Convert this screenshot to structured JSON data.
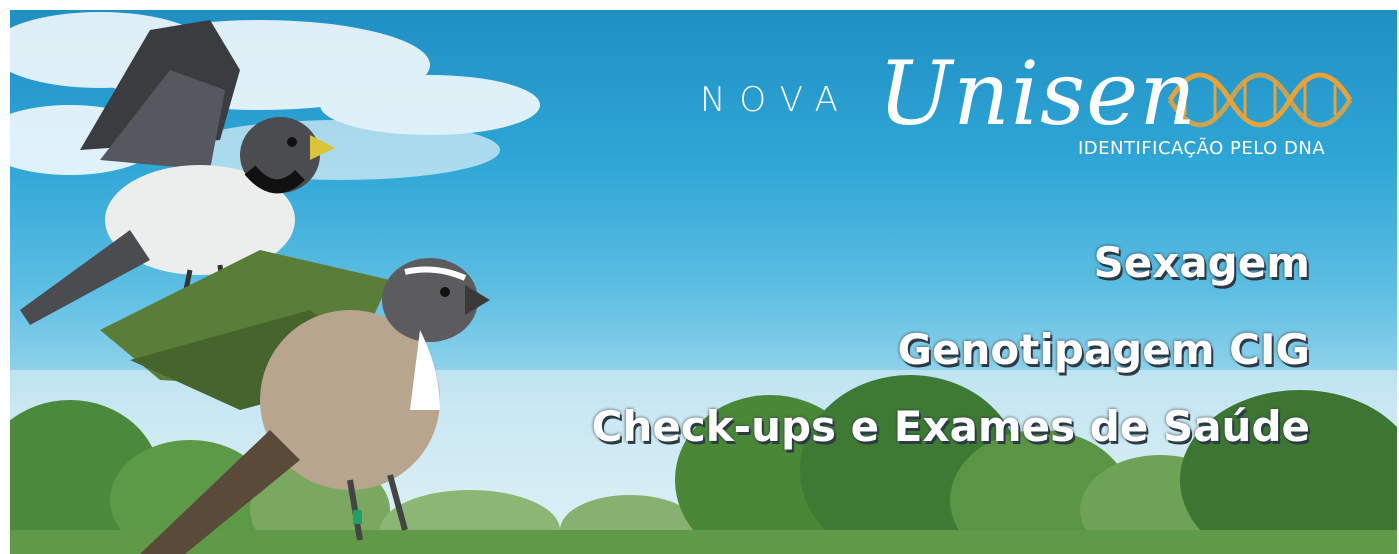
{
  "brand": {
    "prefix": "NOVA",
    "name": "Unisen",
    "tagline": "IDENTIFICAÇÃO PELO DNA",
    "logo_icon": "dna-helix-icon",
    "accent_color": "#e8a23a"
  },
  "services": [
    {
      "label": "Sexagem"
    },
    {
      "label": "Genotipagem CIG"
    },
    {
      "label": "Check-ups e Exames de Saúde"
    }
  ],
  "scene": {
    "sky_color": "#2fa6d6",
    "foliage_color": "#3f7a34",
    "birds": [
      "gray-white-songbird",
      "green-winged-saltator"
    ]
  }
}
